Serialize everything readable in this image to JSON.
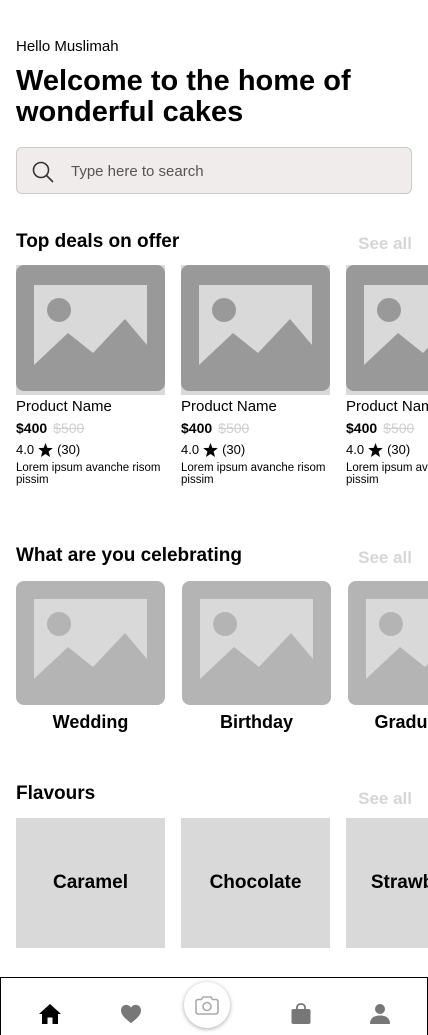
{
  "header": {
    "greeting": "Hello Muslimah",
    "headline": "Welcome to the home of wonderful cakes"
  },
  "search": {
    "placeholder": "Type here to search",
    "icon": "search-icon"
  },
  "top_deals": {
    "title": "Top deals on offer",
    "see_all": "See all",
    "items": [
      {
        "name": "Product Name",
        "price": "$400",
        "old_price": "$500",
        "rating": "4.0",
        "reviews": "(30)",
        "description": "Lorem ipsum avanche risom pissim"
      },
      {
        "name": "Product Name",
        "price": "$400",
        "old_price": "$500",
        "rating": "4.0",
        "reviews": "(30)",
        "description": "Lorem ipsum avanche risom pissim"
      },
      {
        "name": "Product Name",
        "price": "$400",
        "old_price": "$500",
        "rating": "4.0",
        "reviews": "(30)",
        "description": "Lorem ipsum avanche risom pissim"
      }
    ]
  },
  "celebrating": {
    "title": "What are you celebrating",
    "see_all": "See all",
    "items": [
      {
        "label": "Wedding"
      },
      {
        "label": "Birthday"
      },
      {
        "label": "Graduation"
      }
    ]
  },
  "flavours": {
    "title": "Flavours",
    "see_all": "See all",
    "items": [
      {
        "label": "Caramel"
      },
      {
        "label": "Chocolate"
      },
      {
        "label": "Strawberry"
      }
    ]
  },
  "bottom_nav": {
    "items": [
      "home-icon",
      "heart-icon",
      "camera-icon",
      "bag-icon",
      "profile-icon"
    ]
  },
  "colors": {
    "search_bg": "#f1ecec",
    "placeholder_dark": "#999999",
    "placeholder_mid": "#b4b4b4",
    "placeholder_light": "#d9d9d9",
    "muted_text": "#d6d6d6"
  }
}
